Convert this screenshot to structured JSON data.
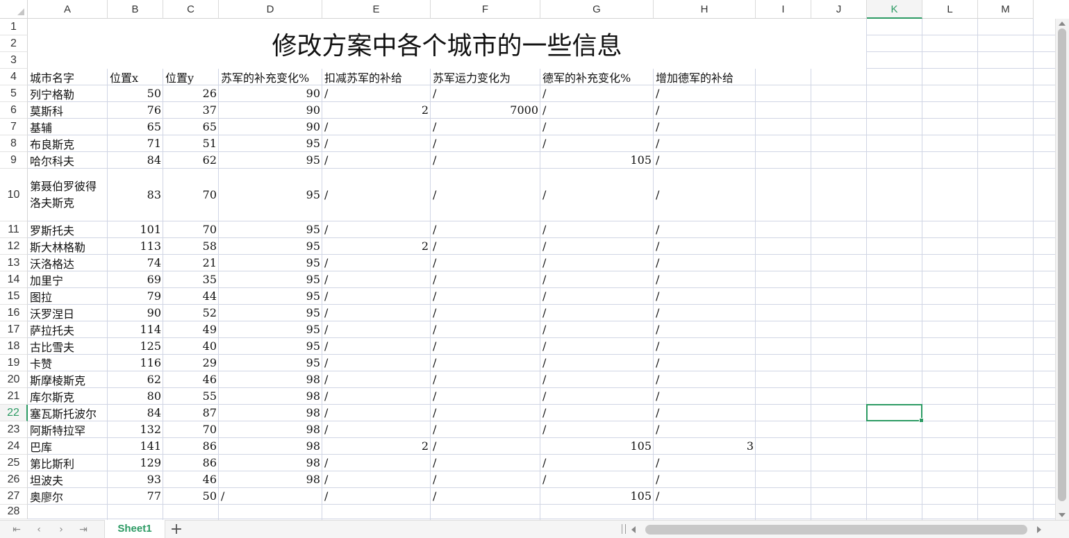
{
  "columns": [
    "A",
    "B",
    "C",
    "D",
    "E",
    "F",
    "G",
    "H",
    "I",
    "J",
    "K",
    "L",
    "M"
  ],
  "active_column": "K",
  "active_row": "22",
  "selected_cell": "K22",
  "title": "修改方案中各个城市的一些信息",
  "headers": {
    "city": "城市名字",
    "x": "位置x",
    "y": "位置y",
    "soviet_supply": "苏军的补充变化%",
    "soviet_supply_cut": "扣减苏军的补给",
    "soviet_transport": "苏军运力变化为",
    "german_supply": "德军的补充变化%",
    "german_supply_add": "增加德军的补给"
  },
  "rows": [
    {
      "row": "5",
      "city": "列宁格勒",
      "x": "50",
      "y": "26",
      "d": "90",
      "e": "/",
      "f": "/",
      "g": "/",
      "h": "/"
    },
    {
      "row": "6",
      "city": "莫斯科",
      "x": "76",
      "y": "37",
      "d": "90",
      "e": "2",
      "f": "7000",
      "g": "/",
      "h": "/"
    },
    {
      "row": "7",
      "city": "基辅",
      "x": "65",
      "y": "65",
      "d": "90",
      "e": "/",
      "f": "/",
      "g": "/",
      "h": "/"
    },
    {
      "row": "8",
      "city": "布良斯克",
      "x": "71",
      "y": "51",
      "d": "95",
      "e": "/",
      "f": "/",
      "g": "/",
      "h": "/"
    },
    {
      "row": "9",
      "city": "哈尔科夫",
      "x": "84",
      "y": "62",
      "d": "95",
      "e": "/",
      "f": "/",
      "g": "105",
      "h": "/"
    },
    {
      "row": "10",
      "city": "第聂伯罗彼得洛夫斯克",
      "x": "83",
      "y": "70",
      "d": "95",
      "e": "/",
      "f": "/",
      "g": "/",
      "h": "/"
    },
    {
      "row": "11",
      "city": "罗斯托夫",
      "x": "101",
      "y": "70",
      "d": "95",
      "e": "/",
      "f": "/",
      "g": "/",
      "h": "/"
    },
    {
      "row": "12",
      "city": "斯大林格勒",
      "x": "113",
      "y": "58",
      "d": "95",
      "e": "2",
      "f": "/",
      "g": "/",
      "h": "/"
    },
    {
      "row": "13",
      "city": "沃洛格达",
      "x": "74",
      "y": "21",
      "d": "95",
      "e": "/",
      "f": "/",
      "g": "/",
      "h": "/"
    },
    {
      "row": "14",
      "city": "加里宁",
      "x": "69",
      "y": "35",
      "d": "95",
      "e": "/",
      "f": "/",
      "g": "/",
      "h": "/"
    },
    {
      "row": "15",
      "city": "图拉",
      "x": "79",
      "y": "44",
      "d": "95",
      "e": "/",
      "f": "/",
      "g": "/",
      "h": "/"
    },
    {
      "row": "16",
      "city": "沃罗涅日",
      "x": "90",
      "y": "52",
      "d": "95",
      "e": "/",
      "f": "/",
      "g": "/",
      "h": "/"
    },
    {
      "row": "17",
      "city": "萨拉托夫",
      "x": "114",
      "y": "49",
      "d": "95",
      "e": "/",
      "f": "/",
      "g": "/",
      "h": "/"
    },
    {
      "row": "18",
      "city": "古比雪夫",
      "x": "125",
      "y": "40",
      "d": "95",
      "e": "/",
      "f": "/",
      "g": "/",
      "h": "/"
    },
    {
      "row": "19",
      "city": "卡赞",
      "x": "116",
      "y": "29",
      "d": "95",
      "e": "/",
      "f": "/",
      "g": "/",
      "h": "/"
    },
    {
      "row": "20",
      "city": "斯摩棱斯克",
      "x": "62",
      "y": "46",
      "d": "98",
      "e": "/",
      "f": "/",
      "g": "/",
      "h": "/"
    },
    {
      "row": "21",
      "city": "库尔斯克",
      "x": "80",
      "y": "55",
      "d": "98",
      "e": "/",
      "f": "/",
      "g": "/",
      "h": "/"
    },
    {
      "row": "22",
      "city": "塞瓦斯托波尔",
      "x": "84",
      "y": "87",
      "d": "98",
      "e": "/",
      "f": "/",
      "g": "/",
      "h": "/"
    },
    {
      "row": "23",
      "city": "阿斯特拉罕",
      "x": "132",
      "y": "70",
      "d": "98",
      "e": "/",
      "f": "/",
      "g": "/",
      "h": "/"
    },
    {
      "row": "24",
      "city": "巴库",
      "x": "141",
      "y": "86",
      "d": "98",
      "e": "2",
      "f": "/",
      "g": "105",
      "h": "3"
    },
    {
      "row": "25",
      "city": "第比斯利",
      "x": "129",
      "y": "86",
      "d": "98",
      "e": "/",
      "f": "/",
      "g": "/",
      "h": "/"
    },
    {
      "row": "26",
      "city": "坦波夫",
      "x": "93",
      "y": "46",
      "d": "98",
      "e": "/",
      "f": "/",
      "g": "/",
      "h": "/"
    },
    {
      "row": "27",
      "city": "奥廖尔",
      "x": "77",
      "y": "50",
      "d": "/",
      "e": "/",
      "f": "/",
      "g": "105",
      "h": "/"
    }
  ],
  "sheet_tab": "Sheet1",
  "icons": {
    "first": "first-sheet-icon",
    "prev": "prev-sheet-icon",
    "next": "next-sheet-icon",
    "last": "last-sheet-icon",
    "add": "add-sheet-icon"
  },
  "accent_color": "#2b9a63"
}
